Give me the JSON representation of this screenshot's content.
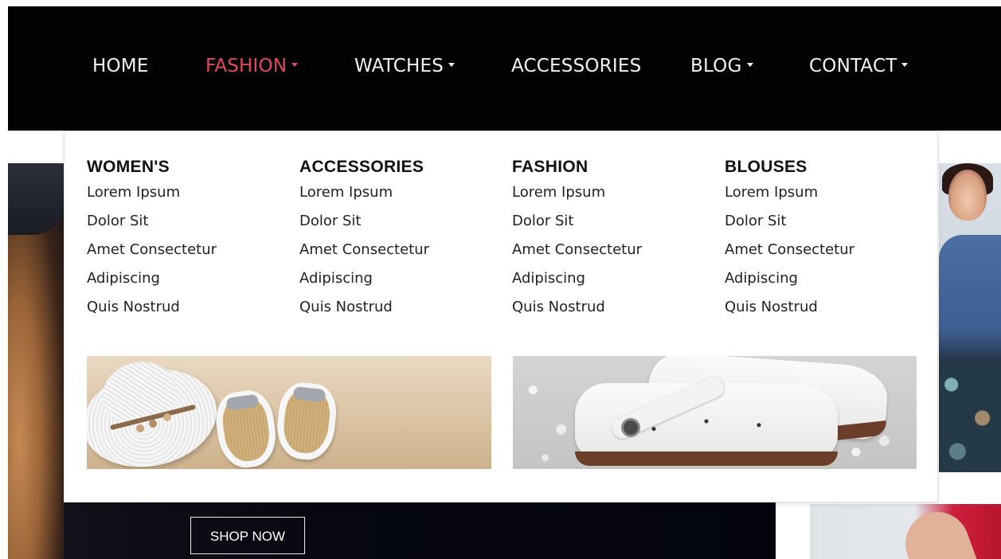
{
  "nav": {
    "items": [
      {
        "label": "HOME",
        "dropdown": false,
        "active": false
      },
      {
        "label": "FASHION",
        "dropdown": true,
        "active": true
      },
      {
        "label": "WATCHES",
        "dropdown": true,
        "active": false
      },
      {
        "label": "ACCESSORIES",
        "dropdown": false,
        "active": false
      },
      {
        "label": "BLOG",
        "dropdown": true,
        "active": false
      },
      {
        "label": "CONTACT",
        "dropdown": true,
        "active": false
      }
    ],
    "active_color": "#e24a5a",
    "bar_color": "#020203"
  },
  "mega_menu": {
    "columns": [
      {
        "title": "WOMEN'S",
        "links": [
          "Lorem Ipsum",
          "Dolor Sit",
          "Amet Consectetur",
          "Adipiscing",
          "Quis Nostrud"
        ]
      },
      {
        "title": "ACCESSORIES",
        "links": [
          "Lorem Ipsum",
          "Dolor Sit",
          "Amet Consectetur",
          "Adipiscing",
          "Quis Nostrud"
        ]
      },
      {
        "title": "FASHION",
        "links": [
          "Lorem Ipsum",
          "Dolor Sit",
          "Amet Consectetur",
          "Adipiscing",
          "Quis Nostrud"
        ]
      },
      {
        "title": "BLOUSES",
        "links": [
          "Lorem Ipsum",
          "Dolor Sit",
          "Amet Consectetur",
          "Adipiscing",
          "Quis Nostrud"
        ]
      }
    ],
    "promos": [
      {
        "icon": "beach-hat-sandals-image"
      },
      {
        "icon": "white-shoes-image"
      }
    ]
  },
  "hero": {
    "shop_button": "SHOP NOW"
  }
}
